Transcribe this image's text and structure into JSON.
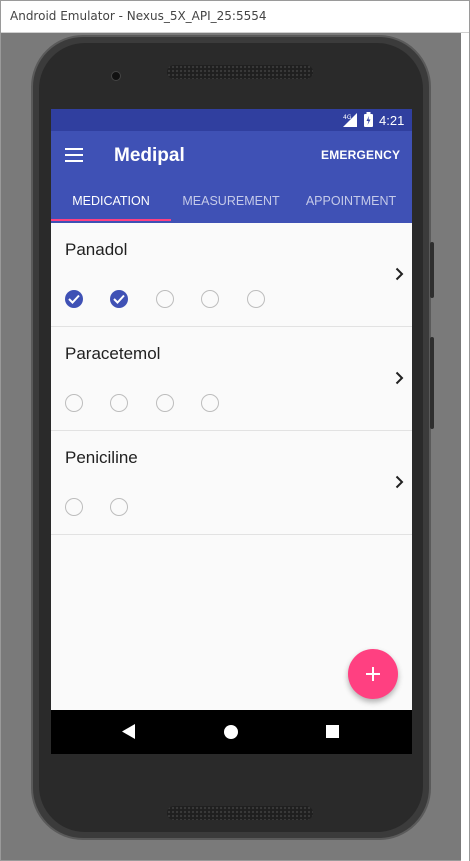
{
  "window": {
    "title": "Android Emulator - Nexus_5X_API_25:5554"
  },
  "statusbar": {
    "network": "4G",
    "time": "4:21"
  },
  "appbar": {
    "title": "Medipal",
    "emergency_label": "EMERGENCY"
  },
  "tabs": [
    {
      "label": "MEDICATION",
      "active": true
    },
    {
      "label": "MEASUREMENT",
      "active": false
    },
    {
      "label": "APPOINTMENT",
      "active": false
    }
  ],
  "medications": [
    {
      "name": "Panadol",
      "doses": [
        true,
        true,
        false,
        false,
        false
      ]
    },
    {
      "name": "Paracetemol",
      "doses": [
        false,
        false,
        false,
        false
      ]
    },
    {
      "name": "Peniciline",
      "doses": [
        false,
        false
      ]
    }
  ],
  "colors": {
    "primary": "#3f51b5",
    "primary_dark": "#303f9f",
    "accent": "#ff4081"
  }
}
